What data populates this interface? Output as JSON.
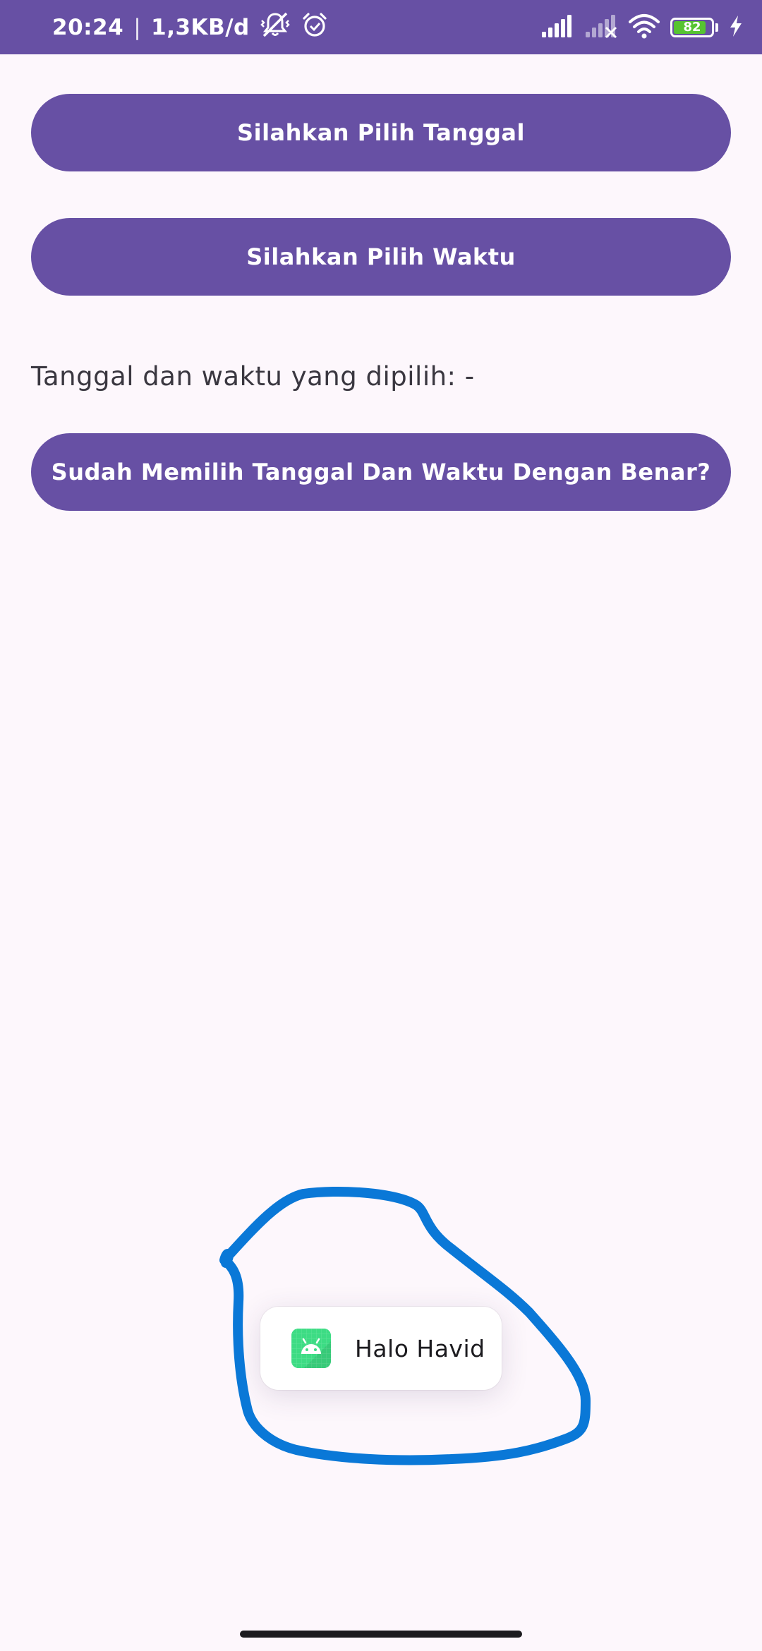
{
  "status_bar": {
    "time": "20:24",
    "separator": "|",
    "network_speed": "1,3KB/d",
    "battery_level": "82",
    "icons": [
      "mute-vibrate-icon",
      "alarm-icon",
      "cellular-signal-icon",
      "cellular-signal-no-service-icon",
      "wifi-icon",
      "battery-icon",
      "charging-icon"
    ]
  },
  "main": {
    "pick_date_label": "Silahkan Pilih Tanggal",
    "pick_time_label": "Silahkan Pilih Waktu",
    "selected_text": "Tanggal dan waktu yang dipilih: -",
    "confirm_label": "Sudah Memilih Tanggal Dan Waktu Dengan Benar?"
  },
  "toast": {
    "icon": "android-app-icon",
    "message": "Halo Havid"
  },
  "colors": {
    "primary": "#6750a4",
    "background": "#fdf7fc",
    "annotation_stroke": "#0a78d7",
    "battery_fill": "#56c431",
    "android_green": "#3ddc84"
  }
}
